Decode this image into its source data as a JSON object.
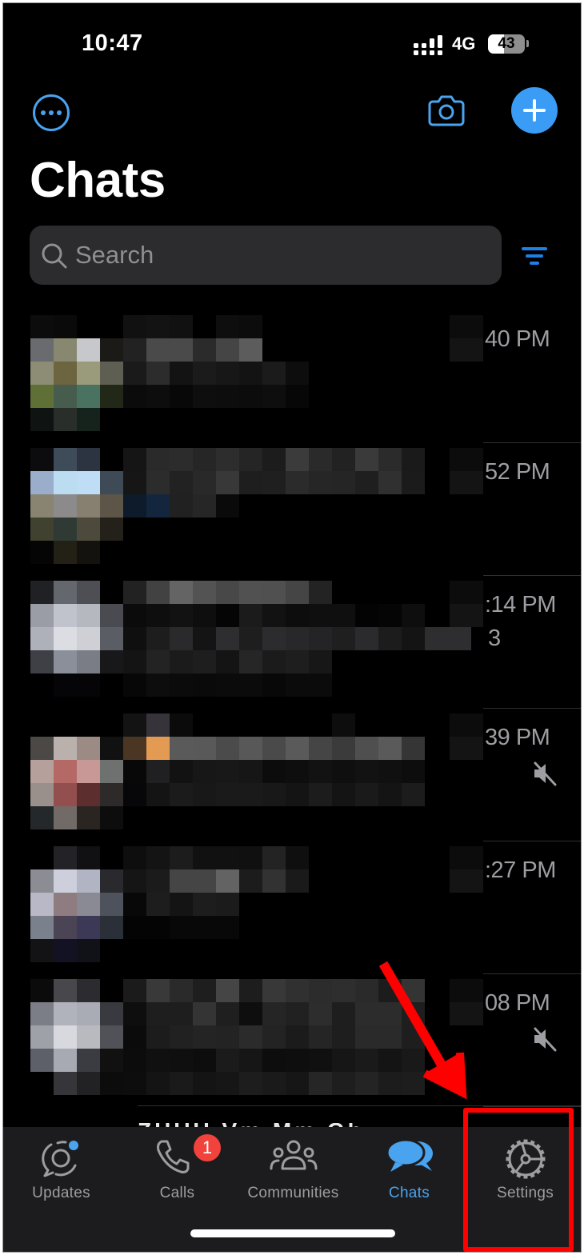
{
  "status_bar": {
    "time": "10:47",
    "network": "4G",
    "battery_percent": 43,
    "battery_label": "43"
  },
  "header": {
    "more_icon": "ellipsis-circle-icon",
    "camera_icon": "camera-icon",
    "new_chat_icon": "plus-icon",
    "title": "Chats"
  },
  "search": {
    "placeholder": "Search",
    "value": "",
    "filter_icon": "filter-icon"
  },
  "chats": [
    {
      "name": "[redacted]",
      "preview": "[redacted]",
      "time": "40 PM",
      "sub": "",
      "muted": false
    },
    {
      "name": "[redacted]",
      "preview": "[redacted]",
      "time": "52 PM",
      "sub": "",
      "muted": false
    },
    {
      "name": "[redacted]",
      "preview": "[redacted]",
      "time": ":14 PM",
      "sub": "3",
      "muted": false
    },
    {
      "name": "[redacted]",
      "preview": "[redacted]",
      "time": "39 PM",
      "sub": "",
      "muted": true
    },
    {
      "name": "[redacted]",
      "preview": "[redacted]",
      "time": ":27 PM",
      "sub": "",
      "muted": false
    },
    {
      "name": "[redacted]",
      "preview": "[redacted]",
      "time": "08 PM",
      "sub": "",
      "muted": true
    }
  ],
  "partial_row_text": "ZHUU  Vm  Mm  Gh",
  "tabbar": {
    "tabs": [
      {
        "label": "Updates",
        "icon": "updates-icon",
        "active": false,
        "dot": true
      },
      {
        "label": "Calls",
        "icon": "phone-icon",
        "active": false,
        "badge": "1"
      },
      {
        "label": "Communities",
        "icon": "communities-icon",
        "active": false
      },
      {
        "label": "Chats",
        "icon": "chats-bubbles-icon",
        "active": true
      },
      {
        "label": "Settings",
        "icon": "gear-icon",
        "active": false
      }
    ]
  },
  "colors": {
    "accent": "#4aa3ef",
    "new_chat_button": "#3a9cf5",
    "badge": "#f2423c",
    "annotation": "#ff0000",
    "background": "#000000",
    "tabbar": "#1c1c1e",
    "search_field": "#2c2c2e"
  },
  "annotation": {
    "highlight_target": "Settings"
  }
}
